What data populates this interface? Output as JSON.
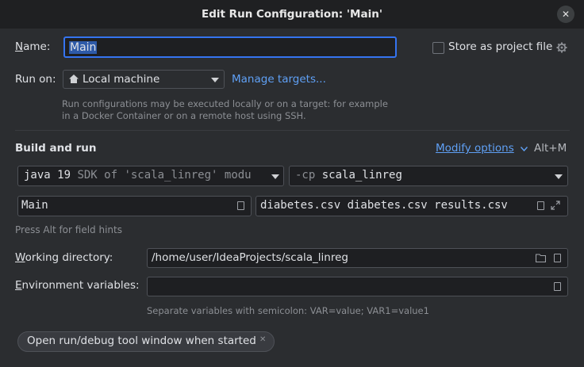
{
  "dialog": {
    "title": "Edit Run Configuration: 'Main'",
    "close_glyph": "✕"
  },
  "name_row": {
    "label_underlined": "N",
    "label_rest": "ame:",
    "value": "Main",
    "store_label": "Store as project file"
  },
  "run_on": {
    "label": "Run on:",
    "target": "Local machine",
    "manage_link": "Manage targets...",
    "hint_line1": "Run configurations may be executed locally or on a target: for example",
    "hint_line2": "in a Docker Container or on a remote host using SSH."
  },
  "build_and_run": {
    "heading": "Build and run",
    "modify_options": "Modify options",
    "modify_shortcut": "Alt+M",
    "jdk_name": "java 19",
    "jdk_detail": "SDK of 'scala_linreg' modu",
    "cp_flag": "-cp",
    "cp_value": "scala_linreg",
    "main_class": "Main",
    "program_args": "diabetes.csv diabetes.csv results.csv",
    "field_hint": "Press Alt for field hints"
  },
  "working_dir": {
    "label_underlined": "W",
    "label_rest": "orking directory:",
    "value": "/home/user/IdeaProjects/scala_linreg"
  },
  "env_vars": {
    "label_underlined": "E",
    "label_rest": "nvironment variables:",
    "value": "",
    "hint": "Separate variables with semicolon: VAR=value; VAR1=value1"
  },
  "chip": {
    "label": "Open run/debug tool window when started",
    "remove_glyph": "✕"
  },
  "colors": {
    "accent": "#3574f0",
    "link": "#5fa0f5",
    "background": "#2b2d30",
    "field_bg": "#1e1f22"
  }
}
